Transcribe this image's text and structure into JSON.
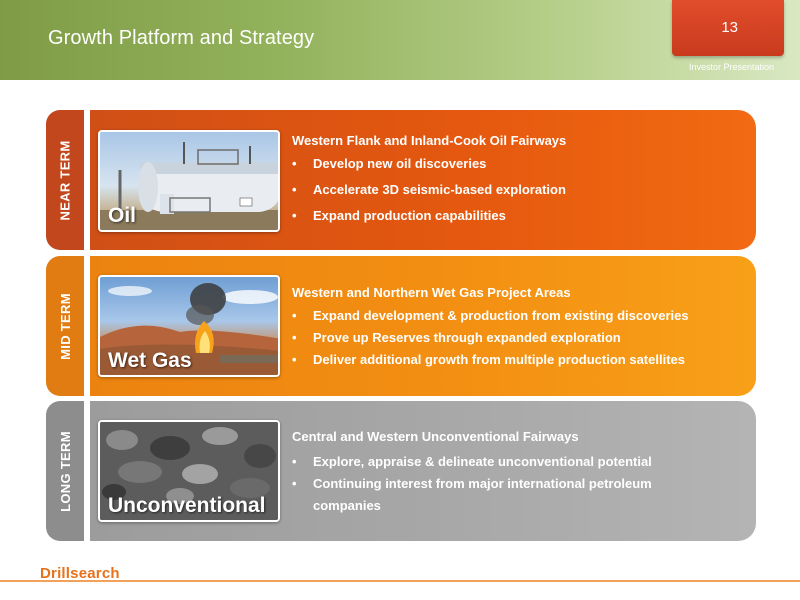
{
  "header": {
    "title": "Growth Platform and Strategy",
    "page_number": "13",
    "subtitle": "Investor Presentation"
  },
  "rows": [
    {
      "term": "NEAR TERM",
      "image_caption": "Oil",
      "heading": "Western Flank and Inland-Cook Oil Fairways",
      "bullets": [
        "Develop new oil discoveries",
        "Accelerate 3D seismic-based exploration",
        "Expand production capabilities"
      ]
    },
    {
      "term": "MID TERM",
      "image_caption": "Wet Gas",
      "heading": "Western and Northern Wet Gas Project Areas",
      "bullets": [
        "Expand development & production from existing discoveries",
        "Prove up Reserves through expanded exploration",
        "Deliver additional growth from multiple production satellites"
      ]
    },
    {
      "term": "LONG TERM",
      "image_caption": "Unconventional",
      "heading": "Central and Western Unconventional Fairways",
      "bullets": [
        "Explore, appraise & delineate unconventional potential",
        "Continuing interest from major international petroleum companies"
      ]
    }
  ],
  "bullet_char": "•",
  "footer": {
    "logo": "Drillsearch"
  },
  "colors": {
    "header_green": "#93b25c",
    "page_box_red": "#d4401f",
    "near_term_orange": "#e4580f",
    "mid_term_orange": "#f38f12",
    "long_term_grey": "#a8a8a8",
    "brand_orange": "#e8711a"
  }
}
